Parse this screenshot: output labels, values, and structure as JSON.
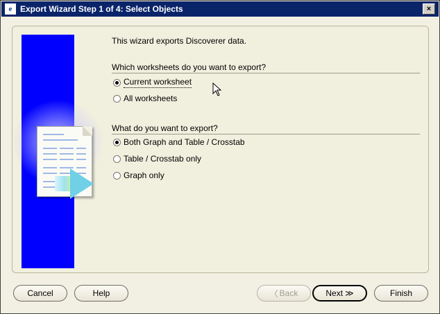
{
  "window": {
    "title": "Export Wizard Step 1 of 4: Select Objects",
    "close_symbol": "×"
  },
  "content": {
    "intro_text": "This wizard exports Discoverer data.",
    "worksheets_section": {
      "label": "Which worksheets do you want to export?",
      "options": [
        {
          "label": "Current worksheet",
          "selected": true
        },
        {
          "label": "All worksheets",
          "selected": false
        }
      ]
    },
    "export_section": {
      "label": "What do you want to export?",
      "options": [
        {
          "label": "Both Graph and Table / Crosstab",
          "selected": true
        },
        {
          "label": "Table / Crosstab only",
          "selected": false
        },
        {
          "label": "Graph only",
          "selected": false
        }
      ]
    }
  },
  "buttons": {
    "cancel": "Cancel",
    "help": "Help",
    "back": "Back",
    "back_arrow": "〈",
    "next": "Next",
    "next_arrow": "≫",
    "finish": "Finish"
  },
  "icons": {
    "title_icon": "discoverer-app-icon",
    "cursor": "mouse-pointer-icon"
  }
}
